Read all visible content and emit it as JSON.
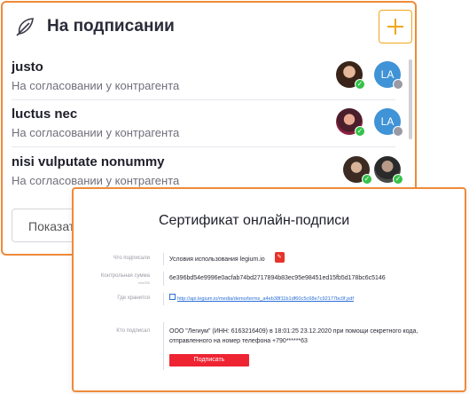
{
  "panel": {
    "title": "На подписании",
    "rows": [
      {
        "title": "justo",
        "status": "На согласовании у контрагента",
        "avatars": [
          {
            "kind": "photo",
            "badge": "ok"
          },
          {
            "kind": "initials",
            "text": "LA",
            "badge": "wait"
          }
        ]
      },
      {
        "title": "luctus nec",
        "status": "На согласовании у контрагента",
        "avatars": [
          {
            "kind": "photo",
            "badge": "ok"
          },
          {
            "kind": "initials",
            "text": "LA",
            "badge": "wait"
          }
        ]
      },
      {
        "title": "nisi vulputate nonummy",
        "status": "На согласовании у контрагента",
        "avatars": [
          {
            "kind": "photo",
            "badge": "ok"
          },
          {
            "kind": "photo",
            "badge": "ok"
          }
        ]
      }
    ],
    "show_more": "Показать"
  },
  "certificate": {
    "title": "Сертификат онлайн-подписи",
    "what_signed_label": "Что подписали",
    "what_signed_value": "Условия использования legium.io",
    "checksum_label": "Контрольная сумма",
    "checksum_sublabel": "sha256",
    "checksum_value": "6e396bd54e9996e0acfab74bd2717894b83ec95e98451ed15fb5d178bc6c5146",
    "stored_label": "Где хранится",
    "stored_value": "http://api.legium.io/media/demo/terms_a4eb38f11b1df60c5c68e7c92177bc0f.pdf",
    "signer_label": "Кто подписал",
    "signer_value_line1": "ООО \"Легиум\" (ИНН: 6163216409) в 18:01:25 23.12.2020 при помощи секретного кода,",
    "signer_value_line2": "отправленного на номер телефона +790******63",
    "sign_button": "Подписать"
  },
  "colors": {
    "accent_orange": "#ef8a3a",
    "add_button": "#f0a61c",
    "sign_button": "#ee2433",
    "avatar_blue": "#3f93d6",
    "ok_badge": "#34c24a"
  },
  "icons": {
    "header": "feather-icon",
    "add": "plus-icon",
    "pdf": "pdf-icon",
    "link": "external-link-icon"
  }
}
